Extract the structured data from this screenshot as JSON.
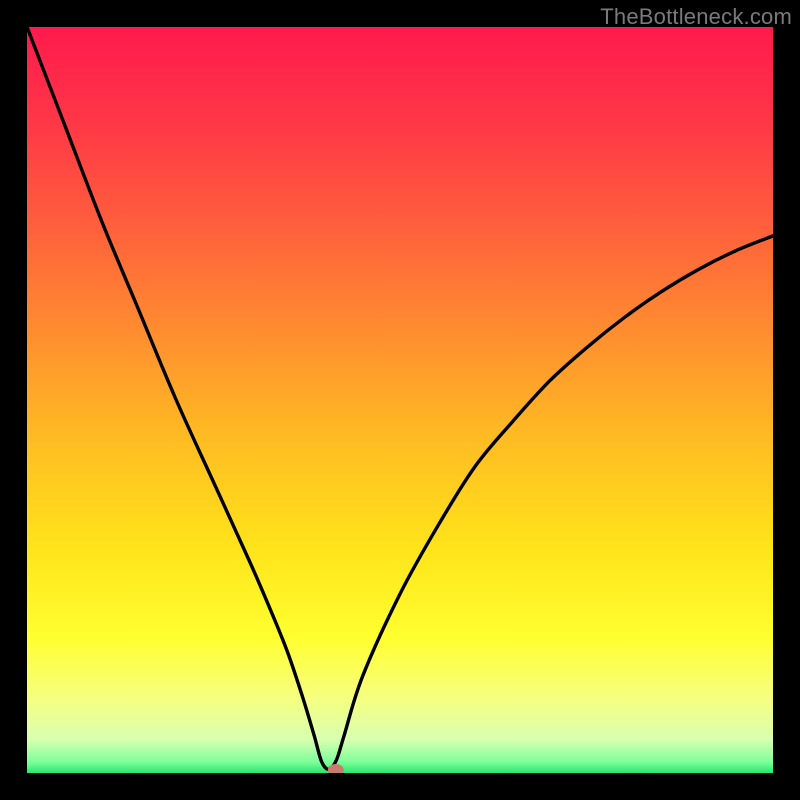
{
  "watermark": "TheBottleneck.com",
  "chart_data": {
    "type": "line",
    "title": "",
    "xlabel": "",
    "ylabel": "",
    "xlim": [
      0,
      100
    ],
    "ylim": [
      0,
      100
    ],
    "x": [
      0,
      5,
      10,
      15,
      20,
      25,
      30,
      33,
      35,
      37,
      38.5,
      39.5,
      40.5,
      41.5,
      42.5,
      45,
      50,
      55,
      60,
      65,
      70,
      75,
      80,
      85,
      90,
      95,
      100
    ],
    "values": [
      100,
      87,
      74,
      62,
      50,
      39,
      28,
      21,
      16,
      10,
      5,
      1.5,
      0.5,
      1.8,
      5,
      13,
      24,
      33,
      41,
      47,
      52.5,
      57,
      61,
      64.5,
      67.5,
      70,
      72
    ],
    "marker": {
      "x": 41.4,
      "y": 0.4,
      "color": "#cc7a6e"
    },
    "gradient_stops": [
      {
        "pos": 0.0,
        "color": "#ff1a4d"
      },
      {
        "pos": 0.12,
        "color": "#ff3547"
      },
      {
        "pos": 0.25,
        "color": "#ff5a3d"
      },
      {
        "pos": 0.4,
        "color": "#ff8a30"
      },
      {
        "pos": 0.55,
        "color": "#ffbb22"
      },
      {
        "pos": 0.7,
        "color": "#ffe41a"
      },
      {
        "pos": 0.82,
        "color": "#ffff30"
      },
      {
        "pos": 0.9,
        "color": "#f6ff80"
      },
      {
        "pos": 0.955,
        "color": "#d8ffb0"
      },
      {
        "pos": 0.985,
        "color": "#7eff9a"
      },
      {
        "pos": 1.0,
        "color": "#28e66e"
      }
    ]
  }
}
